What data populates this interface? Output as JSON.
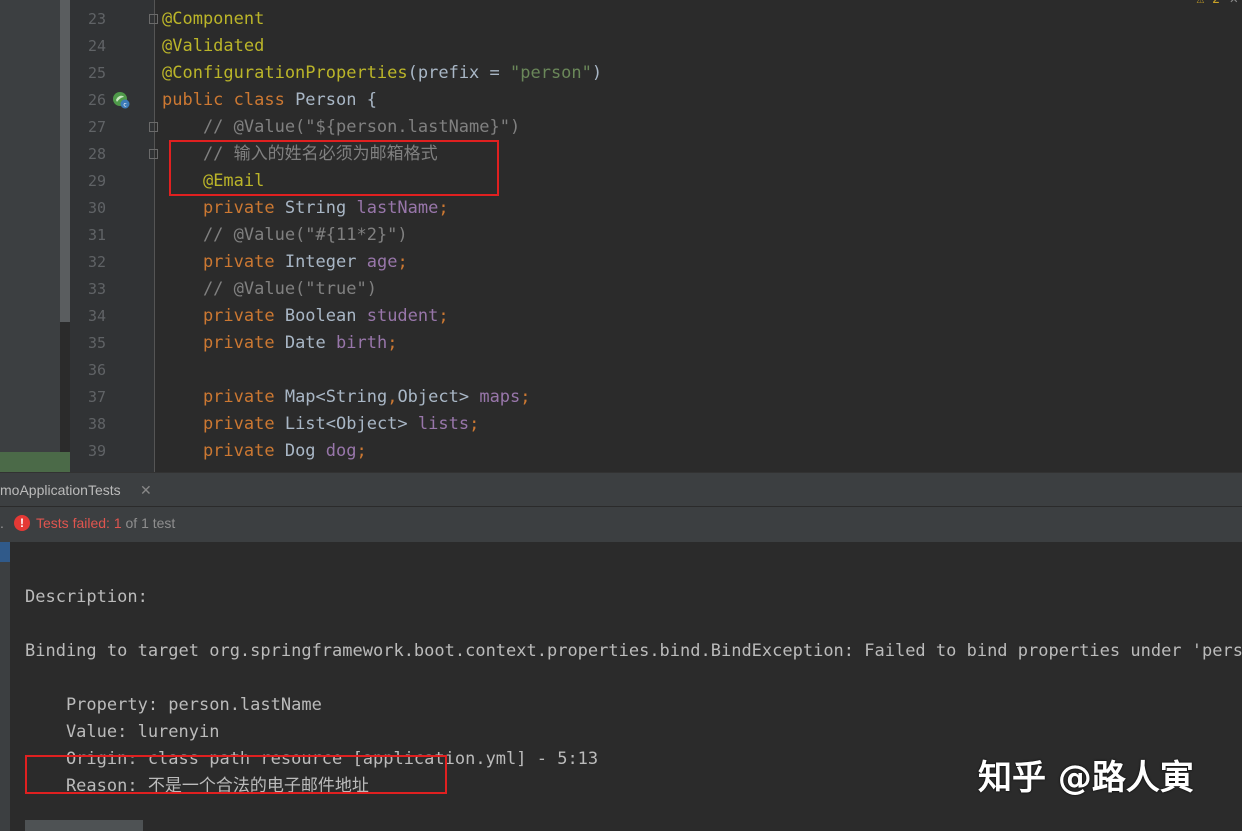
{
  "editor": {
    "warning_count": "2",
    "lines": [
      {
        "num": "23",
        "tokens": [
          {
            "t": "@Component",
            "c": "ann"
          }
        ]
      },
      {
        "num": "24",
        "tokens": [
          {
            "t": "@Validated",
            "c": "ann"
          }
        ]
      },
      {
        "num": "25",
        "tokens": [
          {
            "t": "@ConfigurationProperties",
            "c": "ann"
          },
          {
            "t": "(prefix = ",
            "c": ""
          },
          {
            "t": "\"person\"",
            "c": "str"
          },
          {
            "t": ")",
            "c": ""
          }
        ]
      },
      {
        "num": "26",
        "tokens": [
          {
            "t": "public class ",
            "c": "kw"
          },
          {
            "t": "Person {",
            "c": ""
          }
        ]
      },
      {
        "num": "27",
        "tokens": [
          {
            "t": "    // @Value(\"${person.lastName}\")",
            "c": "cmt"
          }
        ]
      },
      {
        "num": "28",
        "tokens": [
          {
            "t": "    // 输入的姓名必须为邮箱格式",
            "c": "cmt"
          }
        ]
      },
      {
        "num": "29",
        "tokens": [
          {
            "t": "    ",
            "c": ""
          },
          {
            "t": "@Email",
            "c": "ann"
          }
        ]
      },
      {
        "num": "30",
        "tokens": [
          {
            "t": "    private ",
            "c": "kw"
          },
          {
            "t": "String ",
            "c": ""
          },
          {
            "t": "lastName",
            "c": "fld"
          },
          {
            "t": ";",
            "c": "kw"
          }
        ]
      },
      {
        "num": "31",
        "tokens": [
          {
            "t": "    // @Value(\"#{11*2}\")",
            "c": "cmt"
          }
        ]
      },
      {
        "num": "32",
        "tokens": [
          {
            "t": "    private ",
            "c": "kw"
          },
          {
            "t": "Integer ",
            "c": ""
          },
          {
            "t": "age",
            "c": "fld"
          },
          {
            "t": ";",
            "c": "kw"
          }
        ]
      },
      {
        "num": "33",
        "tokens": [
          {
            "t": "    // @Value(\"true\")",
            "c": "cmt"
          }
        ]
      },
      {
        "num": "34",
        "tokens": [
          {
            "t": "    private ",
            "c": "kw"
          },
          {
            "t": "Boolean ",
            "c": ""
          },
          {
            "t": "student",
            "c": "fld"
          },
          {
            "t": ";",
            "c": "kw"
          }
        ]
      },
      {
        "num": "35",
        "tokens": [
          {
            "t": "    private ",
            "c": "kw"
          },
          {
            "t": "Date ",
            "c": ""
          },
          {
            "t": "birth",
            "c": "fld"
          },
          {
            "t": ";",
            "c": "kw"
          }
        ]
      },
      {
        "num": "36",
        "tokens": []
      },
      {
        "num": "37",
        "tokens": [
          {
            "t": "    private ",
            "c": "kw"
          },
          {
            "t": "Map<String",
            "c": ""
          },
          {
            "t": ",",
            "c": "kw"
          },
          {
            "t": "Object> ",
            "c": ""
          },
          {
            "t": "maps",
            "c": "fld"
          },
          {
            "t": ";",
            "c": "kw"
          }
        ]
      },
      {
        "num": "38",
        "tokens": [
          {
            "t": "    private ",
            "c": "kw"
          },
          {
            "t": "List<Object> ",
            "c": ""
          },
          {
            "t": "lists",
            "c": "fld"
          },
          {
            "t": ";",
            "c": "kw"
          }
        ]
      },
      {
        "num": "39",
        "tokens": [
          {
            "t": "    private ",
            "c": "kw"
          },
          {
            "t": "Dog ",
            "c": ""
          },
          {
            "t": "dog",
            "c": "fld"
          },
          {
            "t": ";",
            "c": "kw"
          }
        ]
      }
    ]
  },
  "run_tab": {
    "label": "moApplicationTests",
    "close_symbol": "✕"
  },
  "status": {
    "failed_label": "Tests failed: ",
    "failed_count": "1",
    "of_total": " of 1 test",
    "dot": "."
  },
  "console": {
    "lines": [
      "",
      "Description:",
      "",
      "Binding to target org.springframework.boot.context.properties.bind.BindException: Failed to bind properties under 'person'",
      "",
      "    Property: person.lastName",
      "    Value: lurenyin",
      "    Origin: class path resource [application.yml] - 5:13",
      "    Reason: 不是一个合法的电子邮件地址"
    ]
  },
  "watermark": "知乎 @路人寅",
  "colors": {
    "keyword": "#cc7832",
    "annotation": "#bbb529",
    "string": "#6a8759",
    "comment": "#808080",
    "field": "#9876aa",
    "highlight_box": "#e02020",
    "error": "#e53935"
  }
}
